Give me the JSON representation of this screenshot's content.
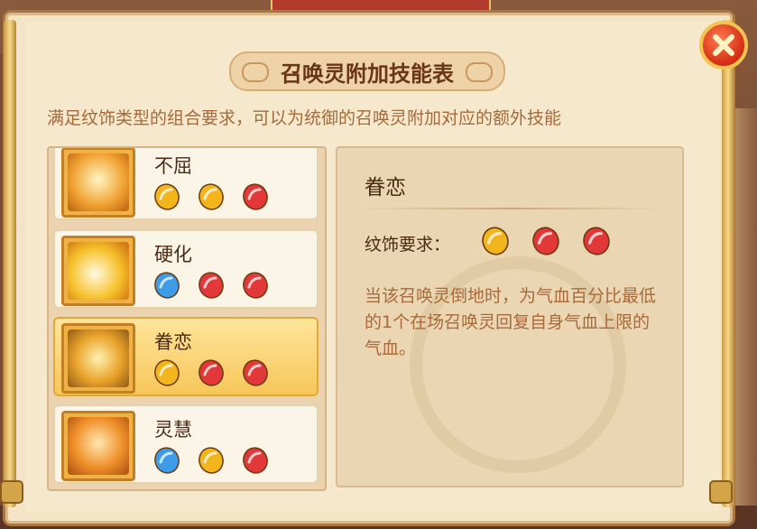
{
  "window": {
    "title": "召唤灵附加技能表",
    "subtitle": "满足纹饰类型的组合要求，可以为统御的召唤灵附加对应的额外技能",
    "close_icon": "close-icon"
  },
  "skills": [
    {
      "name": "不屈",
      "icon": "unyielding-skill-icon",
      "gems": [
        "gold",
        "gold",
        "red"
      ],
      "selected": false
    },
    {
      "name": "硬化",
      "icon": "harden-skill-icon",
      "gems": [
        "blue",
        "red",
        "red"
      ],
      "selected": false
    },
    {
      "name": "眷恋",
      "icon": "attachment-skill-icon",
      "gems": [
        "gold",
        "red",
        "red"
      ],
      "selected": true
    },
    {
      "name": "灵慧",
      "icon": "wisdom-skill-icon",
      "gems": [
        "blue",
        "gold",
        "red"
      ],
      "selected": false
    }
  ],
  "detail": {
    "title": "眷恋",
    "requirement_label": "纹饰要求：",
    "requirement_gems": [
      "gold",
      "red",
      "red"
    ],
    "description": "当该召唤灵倒地时，为气血百分比最低的1个在场召唤灵回复自身气血上限的气血。"
  },
  "colors": {
    "gold": "#f2b51c",
    "red": "#e2383a",
    "blue": "#3d9be8",
    "selected_bg": "#f7c65a",
    "title_text": "#6a3716",
    "desc_text": "#a86a3a"
  }
}
